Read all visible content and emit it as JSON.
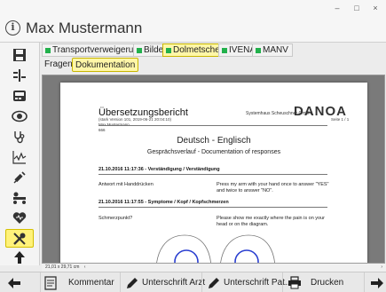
{
  "window": {
    "minimize": "–",
    "maximize": "□",
    "close": "×"
  },
  "header": {
    "patient_name": "Max Mustermann",
    "info_icon": "info-icon"
  },
  "sidebar": {
    "items": [
      {
        "icon": "save-icon"
      },
      {
        "icon": "split-icon"
      },
      {
        "icon": "monitor-icon"
      },
      {
        "icon": "eye-icon"
      },
      {
        "icon": "stethoscope-icon"
      },
      {
        "icon": "ecg-chart-icon"
      },
      {
        "icon": "syringe-icon"
      },
      {
        "icon": "stretcher-icon"
      },
      {
        "icon": "heart-icon"
      },
      {
        "icon": "tools-icon",
        "active": true
      },
      {
        "icon": "arrow-up-icon"
      }
    ]
  },
  "tabs": [
    {
      "label": "Transportverweigerung",
      "active": false
    },
    {
      "label": "Bilder",
      "active": false
    },
    {
      "label": "Dolmetscher",
      "active": true
    },
    {
      "label": "IVENA",
      "active": false
    },
    {
      "label": "MANV",
      "active": false
    }
  ],
  "subtabs": [
    {
      "label": "Fragen",
      "active": false
    },
    {
      "label": "Dokumentation",
      "active": true
    }
  ],
  "document": {
    "title": "Übersetzungsbericht",
    "version": "(stark Version 101, 2019-06-21 20:04:10)",
    "patient": "Max Mustermann",
    "patient_id": "666",
    "company": "Systemhaus Scheuschner GmbH",
    "logo": "DANOA",
    "page": "Seite 1 / 1",
    "heading": "Deutsch - Englisch",
    "subheading": "Gesprächsverlauf - Documentation of responses",
    "entries": [
      {
        "header": "21.10.2016 11:17:36 - Verständigung / Verständigung",
        "left": "Antwort mit Handdrücken",
        "right": "Press my arm with your hand once to answer \"YES\" and twice to answer \"NO\"."
      },
      {
        "header": "21.10.2016 11:17:55 - Symptome / Kopf / Kopfschmerzen",
        "left": "Schmerzpunkt?",
        "right": "Please show me exactly where the pain is on your head or on the diagram."
      }
    ]
  },
  "viewer_footer": {
    "page_size": "21,01 x 29,71 cm"
  },
  "bottom_bar": {
    "kommentar": "Kommentar",
    "unterschrift_arzt": "Unterschrift Arzt",
    "unterschrift_pat": "Unterschrift Pat...",
    "drucken": "Drucken"
  },
  "colors": {
    "accent": "#fff7a8",
    "tab_indicator": "#22b14c",
    "active_side": "#fff27a"
  }
}
